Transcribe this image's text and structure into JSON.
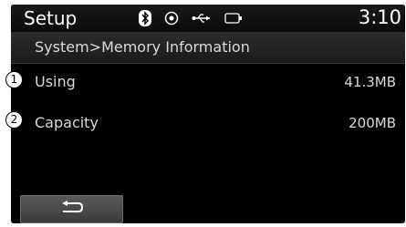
{
  "status_bar": {
    "title": "Setup",
    "time": "3:10",
    "icons": [
      "bluetooth-icon",
      "radio-target-icon",
      "usb-icon",
      "battery-icon"
    ]
  },
  "breadcrumb": "System>Memory Information",
  "rows": [
    {
      "callout": "1",
      "label": "Using",
      "value": "41.3MB"
    },
    {
      "callout": "2",
      "label": "Capacity",
      "value": "200MB"
    }
  ],
  "footer": {
    "back_icon": "back-arrow-icon"
  }
}
